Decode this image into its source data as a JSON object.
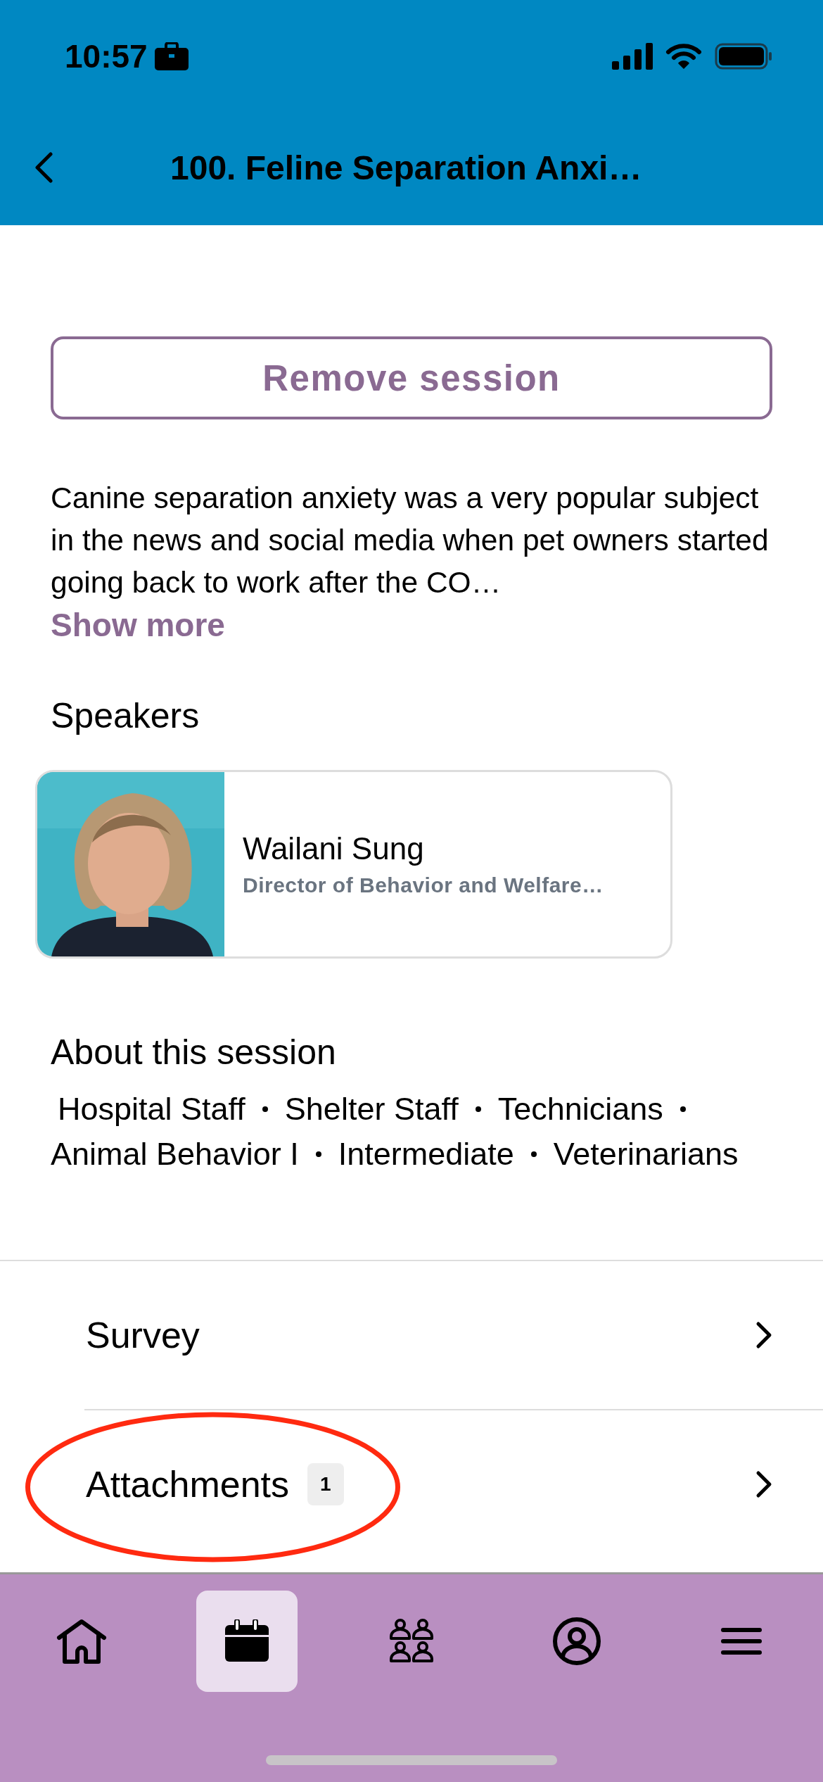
{
  "status_bar": {
    "time": "10:57"
  },
  "header": {
    "title": "100. Feline Separation Anxi…"
  },
  "remove_button": {
    "label": "Remove session"
  },
  "description": {
    "text": "Canine separation anxiety was a very popular subject in the news and social media when pet owners started going back to work after the CO…",
    "show_more": "Show more"
  },
  "speakers": {
    "heading": "Speakers",
    "items": [
      {
        "name": "Wailani Sung",
        "title": "Director of Behavior and Welfare…"
      }
    ]
  },
  "about": {
    "heading": "About this session",
    "tags": [
      "Hospital Staff",
      "Shelter Staff",
      "Technicians",
      "Animal Behavior I",
      "Intermediate",
      "Veterinarians"
    ]
  },
  "links": [
    {
      "label": "Survey"
    },
    {
      "label": "Attachments",
      "badge": "1",
      "highlighted": true
    }
  ],
  "tab_bar": [
    {
      "selected": false
    },
    {
      "selected": true
    },
    {
      "selected": false
    },
    {
      "selected": false
    },
    {
      "selected": false
    }
  ]
}
